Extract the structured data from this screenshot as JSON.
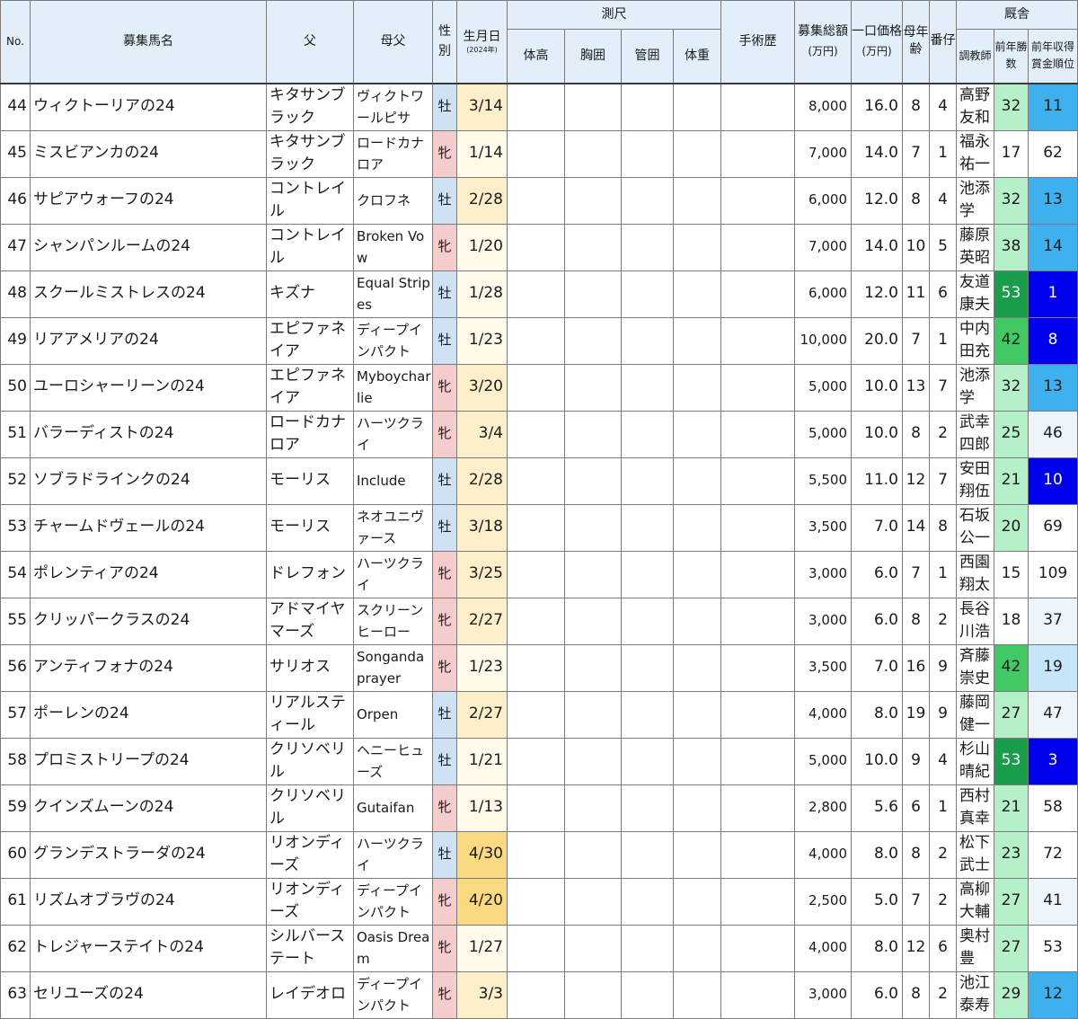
{
  "header": {
    "no": "No.",
    "name": "募集馬名",
    "sire": "父",
    "damsire": "母父",
    "sex": "性別",
    "birth": "生月日",
    "birth_year": "(2024年)",
    "measure_group": "測尺",
    "height": "体高",
    "chest": "胸囲",
    "cannon": "管囲",
    "weight": "体重",
    "surgery": "手術歴",
    "total": "募集総額",
    "total_unit": "(万円)",
    "unit_price": "一口価格",
    "unit_price_unit": "(万円)",
    "dam_age": "母年齢",
    "foal_no": "番仔",
    "stable_group": "厩舎",
    "trainer": "調教師",
    "prev_wins": "前年勝数",
    "prev_rank": "前年収得賞金順位"
  },
  "rows": [
    {
      "no": "44",
      "name": "ウィクトーリアの24",
      "sire": "キタサンブラック",
      "damsire": "ヴィクトワールピサ",
      "sex": "牡",
      "sex_class": "m",
      "birth": "3/14",
      "birth_class": "t2",
      "total": "8,000",
      "price": "16.0",
      "dam_age": "8",
      "foal": "4",
      "trainer": "高野友和",
      "wins": "32",
      "wins_class": "w1",
      "rank": "11",
      "rank_class": "r3"
    },
    {
      "no": "45",
      "name": "ミスビアンカの24",
      "sire": "キタサンブラック",
      "damsire": "ロードカナロア",
      "sex": "牝",
      "sex_class": "f",
      "birth": "1/14",
      "birth_class": "t1",
      "total": "7,000",
      "price": "14.0",
      "dam_age": "7",
      "foal": "1",
      "trainer": "福永祐一",
      "wins": "17",
      "wins_class": "w0",
      "rank": "62",
      "rank_class": "r0"
    },
    {
      "no": "46",
      "name": "サピアウォーフの24",
      "sire": "コントレイル",
      "damsire": "クロフネ",
      "sex": "牡",
      "sex_class": "m",
      "birth": "2/28",
      "birth_class": "t2",
      "total": "6,000",
      "price": "12.0",
      "dam_age": "8",
      "foal": "4",
      "trainer": "池添学",
      "wins": "32",
      "wins_class": "w1",
      "rank": "13",
      "rank_class": "r3"
    },
    {
      "no": "47",
      "name": "シャンパンルームの24",
      "sire": "コントレイル",
      "damsire": "Broken Vow",
      "sex": "牝",
      "sex_class": "f",
      "birth": "1/20",
      "birth_class": "t1",
      "total": "7,000",
      "price": "14.0",
      "dam_age": "10",
      "foal": "5",
      "trainer": "藤原英昭",
      "wins": "38",
      "wins_class": "w1",
      "rank": "14",
      "rank_class": "r3"
    },
    {
      "no": "48",
      "name": "スクールミストレスの24",
      "sire": "キズナ",
      "damsire": "Equal Stripes",
      "sex": "牡",
      "sex_class": "m",
      "birth": "1/28",
      "birth_class": "t1",
      "total": "6,000",
      "price": "12.0",
      "dam_age": "11",
      "foal": "6",
      "trainer": "友道康夫",
      "wins": "53",
      "wins_class": "w3",
      "rank": "1",
      "rank_class": "r4"
    },
    {
      "no": "49",
      "name": "リアアメリアの24",
      "sire": "エピファネイア",
      "damsire": "ディープインパクト",
      "sex": "牡",
      "sex_class": "m",
      "birth": "1/23",
      "birth_class": "t1",
      "total": "10,000",
      "price": "20.0",
      "dam_age": "7",
      "foal": "1",
      "trainer": "中内田充",
      "wins": "42",
      "wins_class": "w2",
      "rank": "8",
      "rank_class": "r4"
    },
    {
      "no": "50",
      "name": "ユーロシャーリーンの24",
      "sire": "エピファネイア",
      "damsire": "Myboycharlie",
      "sex": "牝",
      "sex_class": "f",
      "birth": "3/20",
      "birth_class": "t2",
      "total": "5,000",
      "price": "10.0",
      "dam_age": "13",
      "foal": "7",
      "trainer": "池添学",
      "wins": "32",
      "wins_class": "w1",
      "rank": "13",
      "rank_class": "r3"
    },
    {
      "no": "51",
      "name": "バラーディストの24",
      "sire": "ロードカナロア",
      "damsire": "ハーツクライ",
      "sex": "牝",
      "sex_class": "f",
      "birth": "3/4",
      "birth_class": "t2",
      "total": "5,000",
      "price": "10.0",
      "dam_age": "8",
      "foal": "2",
      "trainer": "武幸四郎",
      "wins": "25",
      "wins_class": "w1",
      "rank": "46",
      "rank_class": "r1"
    },
    {
      "no": "52",
      "name": "ソブラドラインクの24",
      "sire": "モーリス",
      "damsire": "Include",
      "sex": "牡",
      "sex_class": "m",
      "birth": "2/28",
      "birth_class": "t2",
      "total": "5,500",
      "price": "11.0",
      "dam_age": "12",
      "foal": "7",
      "trainer": "安田翔伍",
      "wins": "21",
      "wins_class": "w1",
      "rank": "10",
      "rank_class": "r4"
    },
    {
      "no": "53",
      "name": "チャームドヴェールの24",
      "sire": "モーリス",
      "damsire": "ネオユニヴァース",
      "sex": "牡",
      "sex_class": "m",
      "birth": "3/18",
      "birth_class": "t2",
      "total": "3,500",
      "price": "7.0",
      "dam_age": "14",
      "foal": "8",
      "trainer": "石坂公一",
      "wins": "20",
      "wins_class": "w1",
      "rank": "69",
      "rank_class": "r0"
    },
    {
      "no": "54",
      "name": "ポレンティアの24",
      "sire": "ドレフォン",
      "damsire": "ハーツクライ",
      "sex": "牝",
      "sex_class": "f",
      "birth": "3/25",
      "birth_class": "t2",
      "total": "3,000",
      "price": "6.0",
      "dam_age": "7",
      "foal": "1",
      "trainer": "西園翔太",
      "wins": "15",
      "wins_class": "w0",
      "rank": "109",
      "rank_class": "r0"
    },
    {
      "no": "55",
      "name": "クリッパークラスの24",
      "sire": "アドマイヤマーズ",
      "damsire": "スクリーンヒーロー",
      "sex": "牝",
      "sex_class": "f",
      "birth": "2/27",
      "birth_class": "t2",
      "total": "3,000",
      "price": "6.0",
      "dam_age": "8",
      "foal": "2",
      "trainer": "長谷川浩",
      "wins": "18",
      "wins_class": "w0",
      "rank": "37",
      "rank_class": "r1"
    },
    {
      "no": "56",
      "name": "アンティフォナの24",
      "sire": "サリオス",
      "damsire": "Songandaprayer",
      "sex": "牝",
      "sex_class": "f",
      "birth": "1/23",
      "birth_class": "t1",
      "total": "3,500",
      "price": "7.0",
      "dam_age": "16",
      "foal": "9",
      "trainer": "斉藤崇史",
      "wins": "42",
      "wins_class": "w2",
      "rank": "19",
      "rank_class": "r2"
    },
    {
      "no": "57",
      "name": "ポーレンの24",
      "sire": "リアルスティール",
      "damsire": "Orpen",
      "sex": "牡",
      "sex_class": "m",
      "birth": "2/27",
      "birth_class": "t2",
      "total": "4,000",
      "price": "8.0",
      "dam_age": "19",
      "foal": "9",
      "trainer": "藤岡健一",
      "wins": "27",
      "wins_class": "w1",
      "rank": "47",
      "rank_class": "r1"
    },
    {
      "no": "58",
      "name": "プロミストリープの24",
      "sire": "クリソベリル",
      "damsire": "ヘニーヒューズ",
      "sex": "牡",
      "sex_class": "m",
      "birth": "1/21",
      "birth_class": "t1",
      "total": "5,000",
      "price": "10.0",
      "dam_age": "9",
      "foal": "4",
      "trainer": "杉山晴紀",
      "wins": "53",
      "wins_class": "w3",
      "rank": "3",
      "rank_class": "r4"
    },
    {
      "no": "59",
      "name": "クインズムーンの24",
      "sire": "クリソベリル",
      "damsire": "Gutaifan",
      "sex": "牝",
      "sex_class": "f",
      "birth": "1/13",
      "birth_class": "t1",
      "total": "2,800",
      "price": "5.6",
      "dam_age": "6",
      "foal": "1",
      "trainer": "西村真幸",
      "wins": "21",
      "wins_class": "w1",
      "rank": "58",
      "rank_class": "r0"
    },
    {
      "no": "60",
      "name": "グランデストラーダの24",
      "sire": "リオンディーズ",
      "damsire": "ハーツクライ",
      "sex": "牡",
      "sex_class": "m",
      "birth": "4/30",
      "birth_class": "t3",
      "total": "4,000",
      "price": "8.0",
      "dam_age": "8",
      "foal": "2",
      "trainer": "松下武士",
      "wins": "23",
      "wins_class": "w1",
      "rank": "72",
      "rank_class": "r0"
    },
    {
      "no": "61",
      "name": "リズムオブラヴの24",
      "sire": "リオンディーズ",
      "damsire": "ディープインパクト",
      "sex": "牝",
      "sex_class": "f",
      "birth": "4/20",
      "birth_class": "t3",
      "total": "2,500",
      "price": "5.0",
      "dam_age": "7",
      "foal": "2",
      "trainer": "高柳大輔",
      "wins": "27",
      "wins_class": "w1",
      "rank": "41",
      "rank_class": "r1"
    },
    {
      "no": "62",
      "name": "トレジャーステイトの24",
      "sire": "シルバーステート",
      "damsire": "Oasis Dream",
      "sex": "牝",
      "sex_class": "f",
      "birth": "1/27",
      "birth_class": "t1",
      "total": "4,000",
      "price": "8.0",
      "dam_age": "12",
      "foal": "6",
      "trainer": "奥村豊",
      "wins": "27",
      "wins_class": "w1",
      "rank": "53",
      "rank_class": "r0"
    },
    {
      "no": "63",
      "name": "セリユーズの24",
      "sire": "レイデオロ",
      "damsire": "ディープインパクト",
      "sex": "牝",
      "sex_class": "f",
      "birth": "3/3",
      "birth_class": "t2",
      "total": "3,000",
      "price": "6.0",
      "dam_age": "8",
      "foal": "2",
      "trainer": "池江泰寿",
      "wins": "29",
      "wins_class": "w1",
      "rank": "12",
      "rank_class": "r3"
    }
  ]
}
